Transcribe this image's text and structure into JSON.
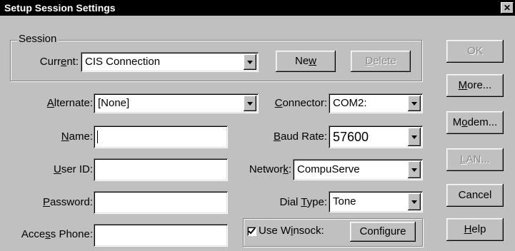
{
  "window": {
    "title": "Setup Session Settings",
    "close_glyph": "✕"
  },
  "session_group": {
    "label": "Session",
    "current_label_pre": "Curr",
    "current_label_key": "e",
    "current_label_post": "nt:",
    "current_value": "CIS Connection",
    "new_pre": "Ne",
    "new_key": "w",
    "new_post": "",
    "delete_pre": "",
    "delete_key": "D",
    "delete_post": "elete"
  },
  "form": {
    "alternate_key": "A",
    "alternate_post": "lternate:",
    "alternate_value": "[None]",
    "name_key": "N",
    "name_post": "ame:",
    "name_value": "",
    "userid_key": "U",
    "userid_post": "ser ID:",
    "userid_value": "",
    "password_key": "P",
    "password_post": "assword:",
    "password_value": "",
    "phone_pre": "Acce",
    "phone_key": "s",
    "phone_post": "s Phone:",
    "phone_value": "",
    "connector_key": "C",
    "connector_post": "onnector:",
    "connector_value": "COM2:",
    "baud_key": "B",
    "baud_post": "aud Rate:",
    "baud_value": "57600",
    "network_pre": "Networ",
    "network_key": "k",
    "network_post": ":",
    "network_value": "CompuServe",
    "dial_pre": "Dial ",
    "dial_key": "T",
    "dial_post": "ype:",
    "dial_value": "Tone",
    "winsock_pre": "Use W",
    "winsock_key": "i",
    "winsock_post": "nsock:",
    "winsock_checked": "true",
    "configure_label": "Configure"
  },
  "side_buttons": {
    "ok": "OK",
    "more_key": "M",
    "more_post": "ore...",
    "modem_pre": "M",
    "modem_key": "o",
    "modem_post": "dem...",
    "lan_key": "L",
    "lan_post": "AN...",
    "cancel": "Cancel",
    "help_key": "H",
    "help_post": "elp"
  }
}
